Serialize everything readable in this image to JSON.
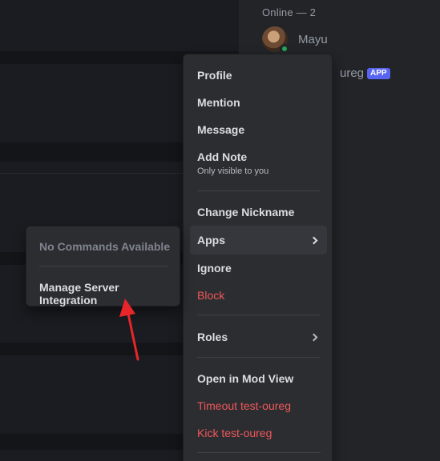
{
  "members": {
    "header": "Online — 2",
    "list": [
      {
        "name": "Mayu",
        "status": "online"
      },
      {
        "name": "ureg",
        "badge": "APP"
      }
    ]
  },
  "context_menu": {
    "items": [
      {
        "label": "Profile"
      },
      {
        "label": "Mention"
      },
      {
        "label": "Message"
      },
      {
        "label": "Add Note",
        "subtext": "Only visible to you"
      },
      {
        "label": "Change Nickname"
      },
      {
        "label": "Apps",
        "has_submenu": true
      },
      {
        "label": "Ignore"
      },
      {
        "label": "Block",
        "danger": true
      },
      {
        "label": "Roles",
        "has_submenu": true
      },
      {
        "label": "Open in Mod View"
      },
      {
        "label": "Timeout test-oureg",
        "danger": true
      },
      {
        "label": "Kick test-oureg",
        "danger": true
      }
    ]
  },
  "apps_submenu": {
    "empty_label": "No Commands Available",
    "manage_label": "Manage Server Integration"
  },
  "colors": {
    "danger": "#f0585a",
    "online": "#23a55a",
    "badge": "#5865f2",
    "annotation": "#e8262a"
  }
}
